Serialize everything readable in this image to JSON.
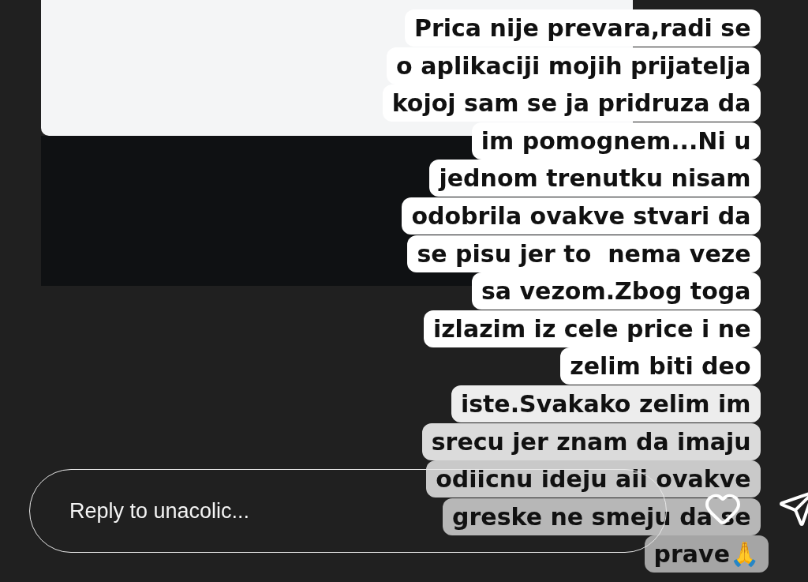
{
  "story": {
    "caption_lines": [
      "Prica nije prevara,radi se",
      "o aplikaciji mojih prijatelja",
      "kojoj sam se ja pridruza da",
      "im pomognem...Ni u",
      "jednom trenutku nisam",
      "odobrila ovakve stvari da",
      "se pisu jer to  nema veze",
      "sa vezom.Zbog toga",
      "izlazim iz cele price i ne",
      "zelim biti deo",
      "iste.Svakako zelim im",
      "srecu jer znam da imaju",
      "odiicnu ideju aii ovakve",
      "greske ne smeju da se",
      "prave🙏"
    ]
  },
  "reply": {
    "placeholder": "Reply to unacolic..."
  }
}
